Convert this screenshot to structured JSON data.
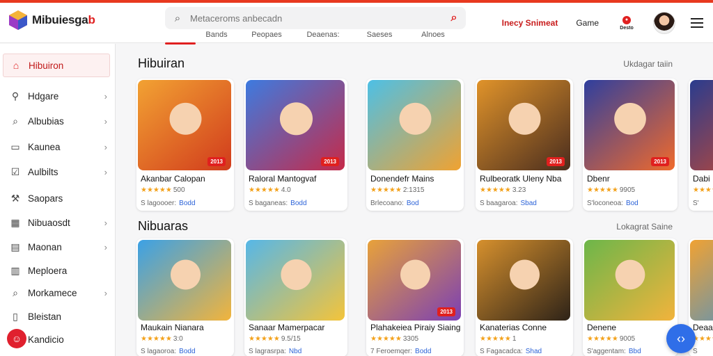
{
  "app": {
    "brand": "Mibuiesgab",
    "brand_main": "Mibuiesga",
    "brand_red": "b"
  },
  "search": {
    "placeholder": "Metaceroms anbecadn"
  },
  "subnav": [
    "",
    "Bands",
    "Peopaes",
    "Deaenas:",
    "Saeses",
    "Alnoes"
  ],
  "header": {
    "link1": "Inecy Snimeat",
    "link2": "Game",
    "notif_label": "Desto"
  },
  "sidebar": {
    "items": [
      {
        "label": "Hibuiron",
        "icon": "home-icon",
        "glyph": "⌂",
        "chevron": false,
        "active": true
      },
      {
        "label": "Hdgare",
        "icon": "tag-icon",
        "glyph": "⚲",
        "chevron": true
      },
      {
        "label": "Albubias",
        "icon": "search-icon",
        "glyph": "⌕",
        "chevron": true
      },
      {
        "label": "Kaunea",
        "icon": "monitor-icon",
        "glyph": "▭",
        "chevron": true
      },
      {
        "label": "Aulbilts",
        "icon": "check-icon",
        "glyph": "☑",
        "chevron": true
      },
      {
        "label": "Saopars",
        "icon": "tool-icon",
        "glyph": "⚒",
        "chevron": false
      },
      {
        "label": "Nibuaosdt",
        "icon": "grid-icon",
        "glyph": "▦",
        "chevron": true
      },
      {
        "label": "Maonan",
        "icon": "chat-icon",
        "glyph": "▤",
        "chevron": true
      },
      {
        "label": "Meploera",
        "icon": "chart-icon",
        "glyph": "▥",
        "chevron": false
      },
      {
        "label": "Morkamece",
        "icon": "magnifier-icon",
        "glyph": "⌕",
        "chevron": true
      },
      {
        "label": "Bleistan",
        "icon": "document-icon",
        "glyph": "▯",
        "chevron": false
      },
      {
        "label": "Kandicio",
        "icon": "user-icon",
        "glyph": "☺",
        "chevron": false
      }
    ]
  },
  "sections": [
    {
      "title": "Hibuiran",
      "link": "Ukdagar taiin",
      "cards": [
        {
          "name": "Akanbar Calopan",
          "stars": "★★★★★",
          "rating": "500",
          "meta": "S lagoooer:",
          "link": "Bodd",
          "badge": "2013",
          "bg1": "#f2a233",
          "bg2": "#d13b1c"
        },
        {
          "name": "Raloral Mantogvaf",
          "stars": "★★★★★",
          "rating": "4.0",
          "meta": "S baganeas:",
          "link": "Bodd",
          "badge": "2013",
          "bg1": "#3d7be0",
          "bg2": "#c62a49"
        },
        {
          "name": "Donendefr Mains",
          "stars": "★★★★★",
          "rating": "2:1315",
          "meta": "Brlecoano:",
          "link": "Bod",
          "badge": "",
          "bg1": "#4dc0e6",
          "bg2": "#f0a231"
        },
        {
          "name": "Rulbeoratk Uleny Nba",
          "stars": "★★★★★",
          "rating": "3.23",
          "meta": "S baagaroa:",
          "link": "Sbad",
          "badge": "2013",
          "bg1": "#e0932a",
          "bg2": "#4a2d1e"
        },
        {
          "name": "Dbenr",
          "stars": "★★★★★",
          "rating": "9905",
          "meta": "S'loconeoa:",
          "link": "Bod",
          "badge": "2013",
          "bg1": "#2f3f9e",
          "bg2": "#f06a2c"
        },
        {
          "name": "Dabi",
          "stars": "★★★★★",
          "rating": "",
          "meta": "S'",
          "link": "",
          "badge": "",
          "bg1": "#2a3c8e",
          "bg2": "#d34a2a"
        }
      ]
    },
    {
      "title": "Nibuaras",
      "link": "Lokagrat Saine",
      "cards": [
        {
          "name": "Maukain Nianara",
          "stars": "★★★★★",
          "rating": "3:0",
          "meta": "S lagaoroa:",
          "link": "Bodd",
          "badge": "",
          "bg1": "#3ba1e6",
          "bg2": "#f2b43c"
        },
        {
          "name": "Sanaar Mamerpacar",
          "stars": "★★★★★",
          "rating": "9.5/15",
          "meta": "S lagrasrpa:",
          "link": "Nbd",
          "badge": "",
          "bg1": "#56b7e8",
          "bg2": "#f4c43a"
        },
        {
          "name": "Plahakeiea Piraiy Siaing",
          "stars": "★★★★★",
          "rating": "3305",
          "meta": "7 Feroemqer:",
          "link": "Bodd",
          "badge": "2013",
          "bg1": "#e8a23a",
          "bg2": "#7b3fb4"
        },
        {
          "name": "Kanaterias Conne",
          "stars": "★★★★★",
          "rating": "1",
          "meta": "S Fagacadca:",
          "link": "Shad",
          "badge": "",
          "bg1": "#d6902d",
          "bg2": "#2e2318"
        },
        {
          "name": "Denene",
          "stars": "★★★★★",
          "rating": "9005",
          "meta": "S'aggentam:",
          "link": "Bbd",
          "badge": "",
          "bg1": "#6cb64a",
          "bg2": "#f2b33c"
        },
        {
          "name": "Deaa",
          "stars": "★★★★★",
          "rating": "",
          "meta": "S",
          "link": "",
          "badge": "",
          "bg1": "#f0a233",
          "bg2": "#3a8fd6"
        }
      ]
    }
  ],
  "fab": {
    "glyph": "‹›"
  },
  "colors": {
    "accent": "#e02020",
    "link": "#2c63d8"
  }
}
